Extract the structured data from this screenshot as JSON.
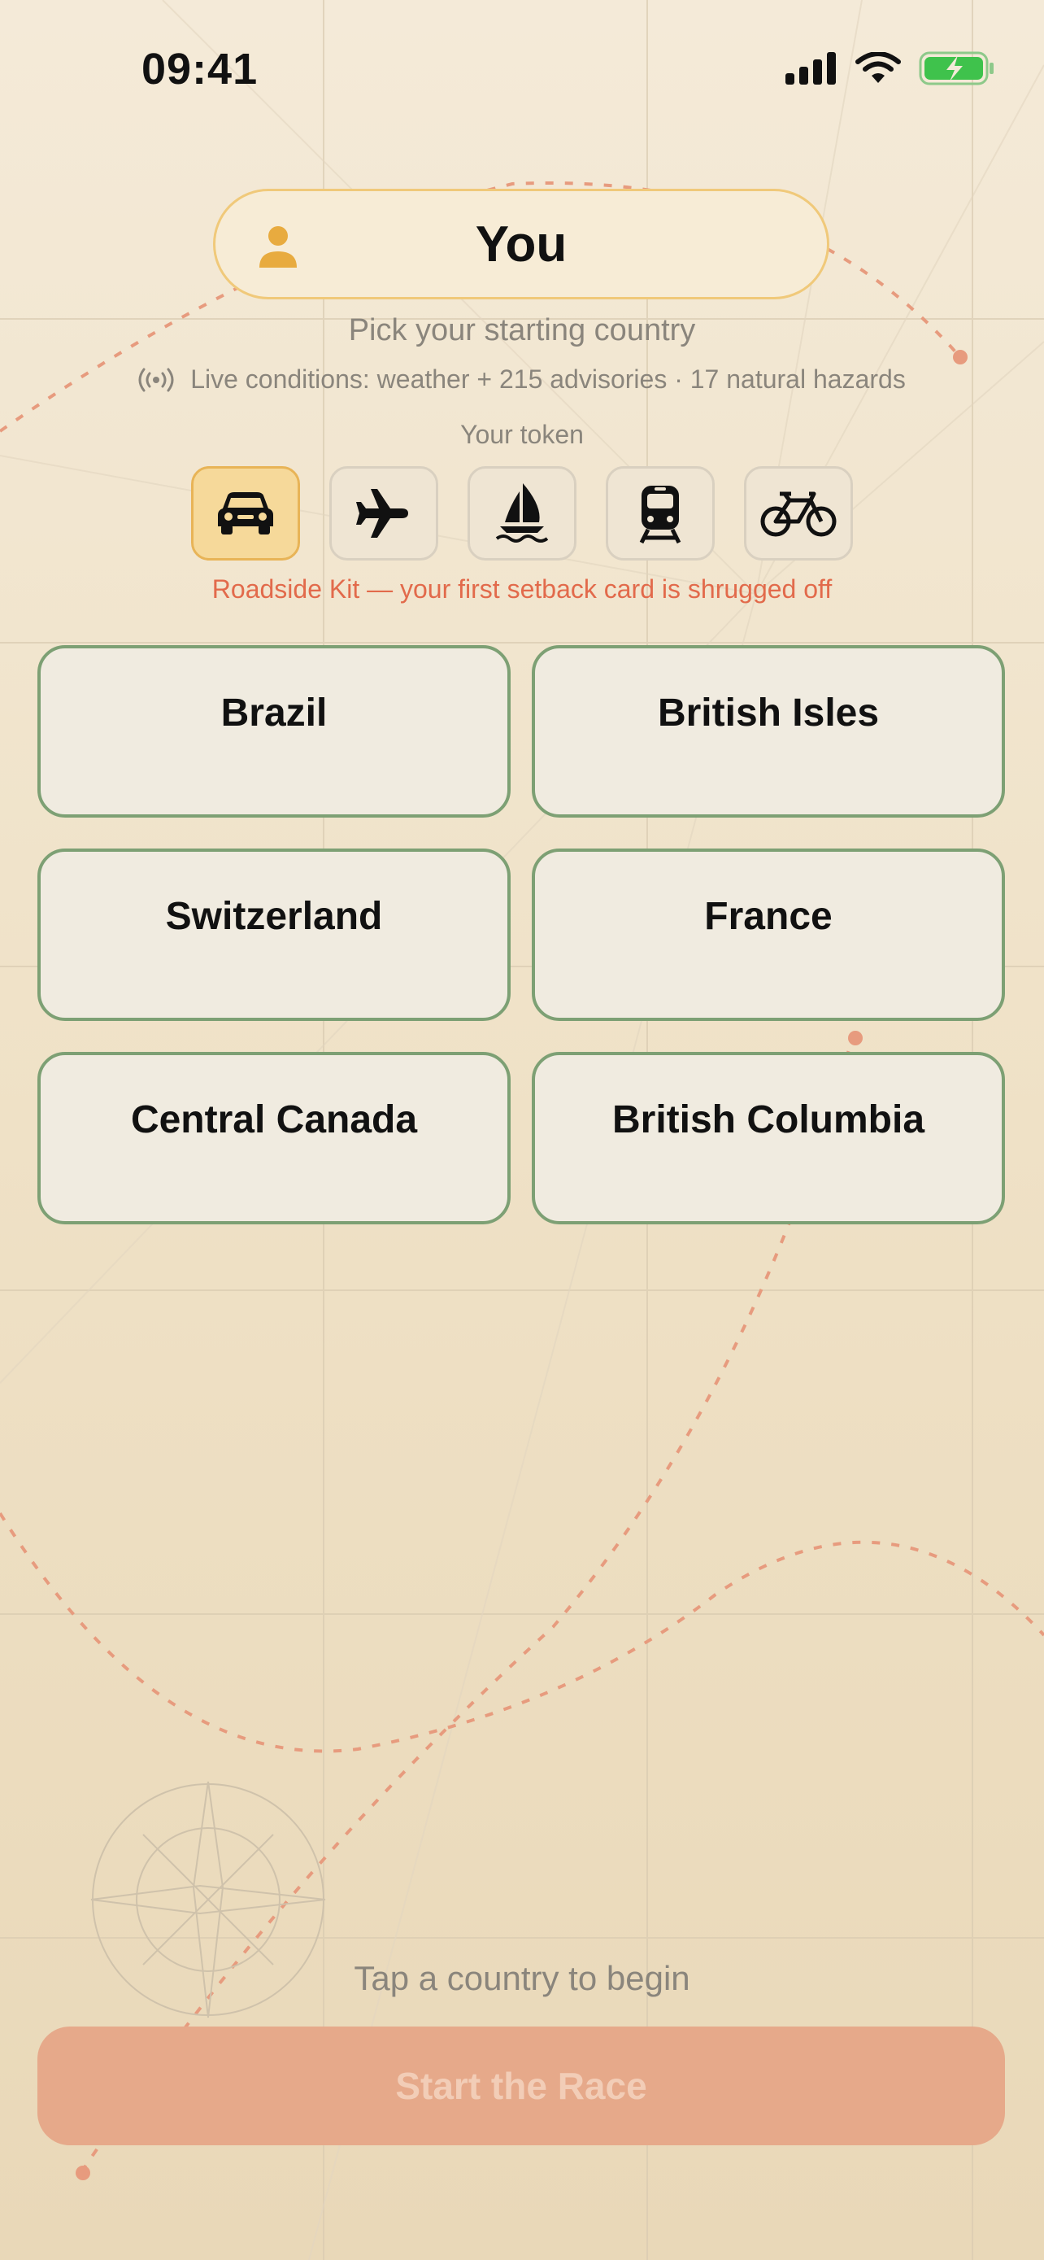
{
  "status": {
    "time": "09:41"
  },
  "player": {
    "name": "You"
  },
  "subtitle": "Pick your starting country",
  "live_conditions": "Live conditions: weather + 215 advisories · 17 natural hazards",
  "token_label": "Your token",
  "tokens": [
    {
      "name": "car",
      "selected": true
    },
    {
      "name": "airplane",
      "selected": false
    },
    {
      "name": "sailboat",
      "selected": false
    },
    {
      "name": "train",
      "selected": false
    },
    {
      "name": "bicycle",
      "selected": false
    }
  ],
  "token_perk": "Roadside Kit — your first setback card is shrugged off",
  "countries": [
    "Brazil",
    "British Isles",
    "Switzerland",
    "France",
    "Central Canada",
    "British Columbia"
  ],
  "hint": "Tap a country to begin",
  "start_button": "Start the Race",
  "colors": {
    "accent": "#e26a4b",
    "pill_border": "#f0c97a",
    "card_border": "#7da074",
    "selected_token": "#f6d99a",
    "button": "#e6a98a"
  }
}
